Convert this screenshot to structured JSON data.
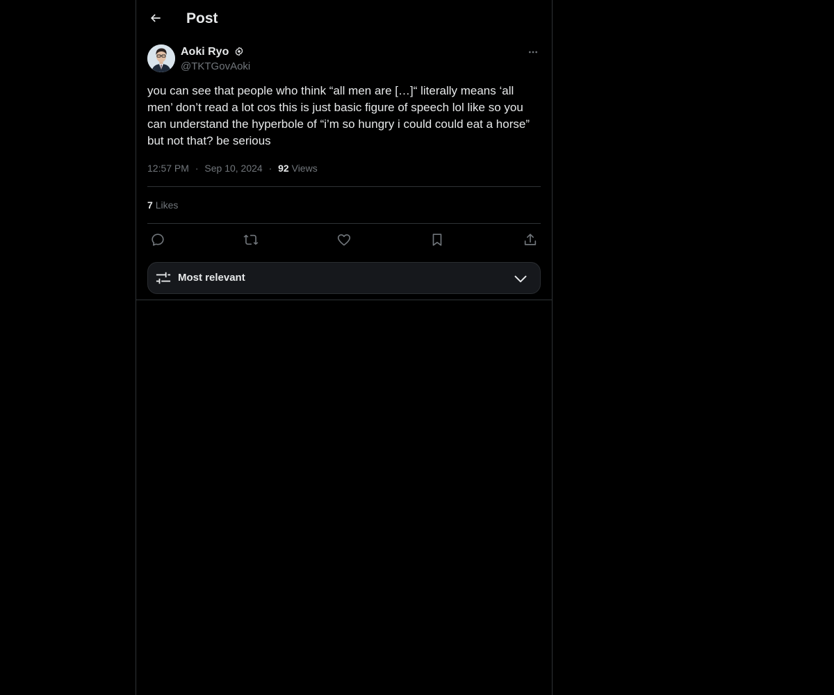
{
  "header": {
    "title": "Post"
  },
  "post": {
    "author_name": "Aoki Ryo",
    "author_handle": "@TKTGovAoki",
    "text": "you can see that people who think “all men are […]“ literally means ‘all men’ don’t read a lot cos this is just basic figure of speech lol like so you can understand the hyperbole of “i’m so hungry i could could eat a horse” but not that? be serious",
    "time": "12:57 PM",
    "date": "Sep 10, 2024",
    "separator": "·",
    "views_count": "92",
    "views_label": "Views",
    "likes_count": "7",
    "likes_label": "Likes"
  },
  "actions": [
    {
      "name": "reply",
      "icon": "reply-icon"
    },
    {
      "name": "repost",
      "icon": "repost-icon"
    },
    {
      "name": "like",
      "icon": "heart-icon"
    },
    {
      "name": "bookmark",
      "icon": "bookmark-icon"
    },
    {
      "name": "share",
      "icon": "share-icon"
    }
  ],
  "sort": {
    "label": "Most relevant",
    "icon": "sliders-icon"
  },
  "colors": {
    "background": "#000000",
    "text": "#e7e9ea",
    "secondary_text": "#71767b",
    "divider": "#2f3336",
    "sort_bar": "#16181c"
  }
}
